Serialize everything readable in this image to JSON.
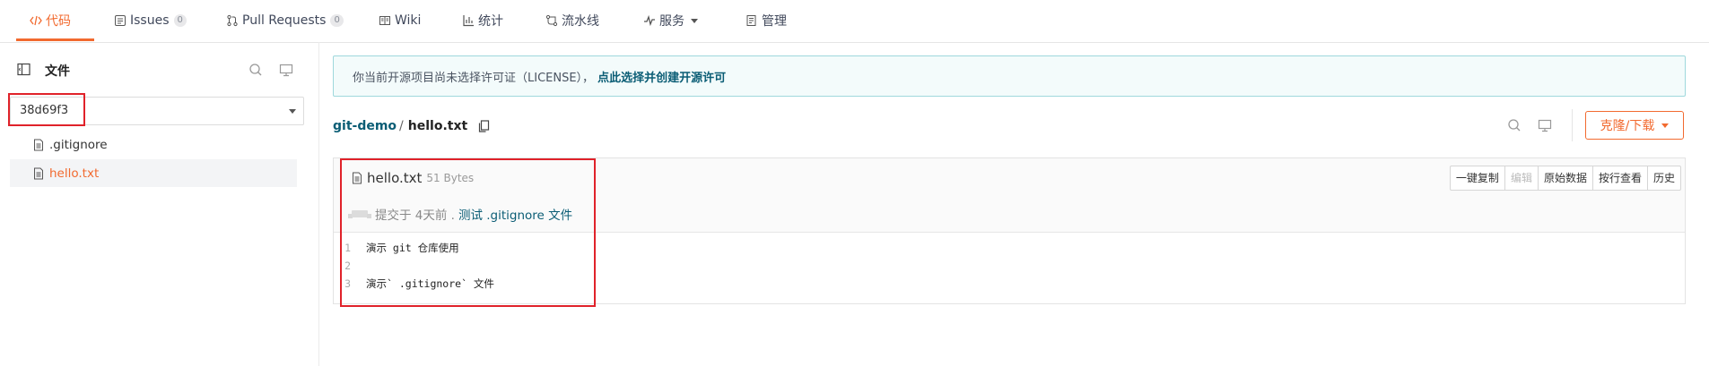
{
  "nav": {
    "tabs": [
      {
        "label": "代码",
        "active": true
      },
      {
        "label": "Issues",
        "count": "0"
      },
      {
        "label": "Pull Requests",
        "count": "0"
      },
      {
        "label": "Wiki"
      },
      {
        "label": "统计"
      },
      {
        "label": "流水线"
      },
      {
        "label": "服务"
      },
      {
        "label": "管理"
      }
    ]
  },
  "sidebar": {
    "title": "文件",
    "branch": "38d69f3",
    "files": [
      {
        "name": ".gitignore",
        "selected": false
      },
      {
        "name": "hello.txt",
        "selected": true
      }
    ]
  },
  "notice": {
    "text": "你当前开源项目尚未选择许可证（LICENSE），",
    "link": "点此选择并创建开源许可"
  },
  "breadcrumb": {
    "repo": "git-demo",
    "separator": "/",
    "file": "hello.txt"
  },
  "clone_button": {
    "label": "克隆/下载"
  },
  "file": {
    "name": "hello.txt",
    "size": "51 Bytes",
    "commit_prefix": "提交于 4天前 .",
    "commit_message": "测试 .gitignore 文件",
    "actions": [
      {
        "label": "一键复制",
        "disabled": false
      },
      {
        "label": "编辑",
        "disabled": true
      },
      {
        "label": "原始数据",
        "disabled": false
      },
      {
        "label": "按行查看",
        "disabled": false
      },
      {
        "label": "历史",
        "disabled": false
      }
    ],
    "lines": [
      {
        "num": "1",
        "text": "演示 git 仓库使用"
      },
      {
        "num": "2",
        "text": ""
      },
      {
        "num": "3",
        "text": "演示` .gitignore` 文件"
      }
    ]
  },
  "colors": {
    "accent": "#f26a2f",
    "link": "#0b5d75",
    "highlight_box": "#e0222a"
  }
}
